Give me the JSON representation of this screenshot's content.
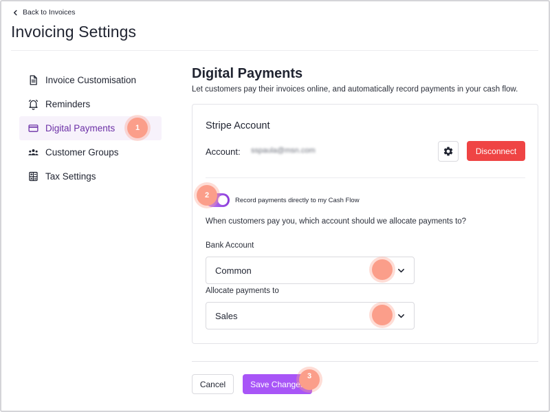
{
  "nav": {
    "back_label": "Back to Invoices",
    "page_title": "Invoicing Settings"
  },
  "sidebar": {
    "items": [
      {
        "label": "Invoice Customisation",
        "icon": "document-icon",
        "active": false
      },
      {
        "label": "Reminders",
        "icon": "bell-icon",
        "active": false
      },
      {
        "label": "Digital Payments",
        "icon": "credit-card-icon",
        "active": true
      },
      {
        "label": "Customer Groups",
        "icon": "users-icon",
        "active": false
      },
      {
        "label": "Tax Settings",
        "icon": "calculator-icon",
        "active": false
      }
    ]
  },
  "section": {
    "title": "Digital Payments",
    "description": "Let customers pay their invoices online, and automatically record payments in your cash flow."
  },
  "stripe": {
    "title": "Stripe Account",
    "account_label": "Account:",
    "account_value": "sspaula@msn.com",
    "disconnect_label": "Disconnect"
  },
  "cashflow": {
    "toggle_label": "Record payments directly to my Cash Flow",
    "toggle_on": true,
    "question": "When customers pay you, which account should we allocate payments to?"
  },
  "bank_account": {
    "label": "Bank Account",
    "selected": "Common"
  },
  "allocate": {
    "label": "Allocate payments to",
    "selected": "Sales"
  },
  "footer": {
    "cancel_label": "Cancel",
    "save_label": "Save Changes"
  },
  "markers": {
    "one": "1",
    "two": "2",
    "three": "3"
  },
  "colors": {
    "accent": "#a855f7",
    "active_text": "#6b2fa6",
    "active_bg": "#f7f2fb",
    "danger": "#ef4444",
    "marker": "#fb9e8a"
  }
}
